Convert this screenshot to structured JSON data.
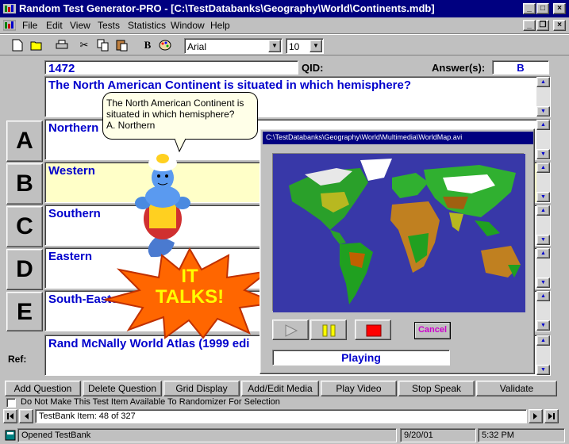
{
  "window": {
    "title": "Random Test Generator-PRO - [C:\\TestDatabanks\\Geography\\World\\Continents.mdb]"
  },
  "menu": [
    "File",
    "Edit",
    "View",
    "Tests",
    "Statistics",
    "Window",
    "Help"
  ],
  "toolbar": {
    "font_name": "Arial",
    "font_size": "10",
    "bold_label": "B"
  },
  "question": {
    "id_value": "1472",
    "qid_label": "QID:",
    "answer_label": "Answer(s):",
    "answer_value": "B",
    "text": "The North American Continent is situated in which hemisphere?"
  },
  "choices": [
    {
      "letter": "A",
      "text": "Northern"
    },
    {
      "letter": "B",
      "text": "Western"
    },
    {
      "letter": "C",
      "text": "Southern"
    },
    {
      "letter": "D",
      "text": "Eastern"
    },
    {
      "letter": "E",
      "text": "South-Eastern"
    }
  ],
  "ref": {
    "label": "Ref:",
    "text": "Rand McNally World Atlas (1999 edi"
  },
  "speech_bubble": {
    "line1": "The North American Continent is",
    "line2": "situated in which hemisphere?",
    "line3": "A.  Northern"
  },
  "starburst": {
    "line1": "IT",
    "line2": "TALKS!"
  },
  "video": {
    "title": "C:\\TestDatabanks\\Geography\\World\\Multimedia\\WorldMap.avi",
    "cancel_label": "Cancel",
    "status": "Playing"
  },
  "actions": {
    "add_question": "Add Question",
    "delete_question": "Delete Question",
    "grid_display": "Grid Display",
    "add_edit_media": "Add/Edit Media",
    "play_video": "Play Video",
    "stop_speak": "Stop Speak",
    "validate": "Validate"
  },
  "randomizer_checkbox": {
    "label": "Do Not Make This Test Item Available To Randomizer For Selection",
    "checked": false
  },
  "navigator": {
    "label": "TestBank Item: 48 of 327"
  },
  "status": {
    "message": "Opened TestBank",
    "date": "9/20/01",
    "time": "5:32 PM"
  },
  "colors": {
    "title_bar": "#000080",
    "field_text": "#0000cc",
    "selected_choice": "#ffffc8",
    "starburst": "#ff6600",
    "starburst_text": "#ffff00",
    "cancel_text": "#cc00cc"
  }
}
